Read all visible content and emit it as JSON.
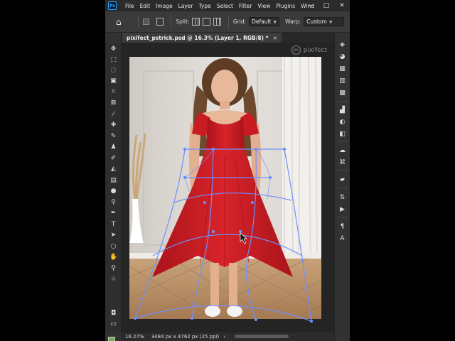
{
  "app": {
    "logo": "Ps",
    "menu": [
      "File",
      "Edit",
      "Image",
      "Layer",
      "Type",
      "Select",
      "Filter",
      "View",
      "Plugins",
      "Wind"
    ],
    "window_controls": {
      "minimize": "—",
      "maximize": "□",
      "close": "✕"
    }
  },
  "options": {
    "split_label": "Split:",
    "grid_label": "Grid:",
    "grid_value": "Default",
    "warp_label": "Warp:",
    "warp_value": "Custom"
  },
  "document": {
    "tab_title": "pixifect_pstrick.psd @ 16.3% (Layer 1, RGB/8) *",
    "close": "×"
  },
  "watermark": {
    "logo": "px",
    "text": "pixifect"
  },
  "status": {
    "zoom": "16.27%",
    "dimensions": "3484 px x 4762 px (25 ppi)",
    "arrow": "›"
  },
  "colors": {
    "foreground": "#6ab04c",
    "background": "#ffffff",
    "warp_mesh": "#6f8fff",
    "dress": "#d01e24"
  },
  "tools": [
    "move-tool",
    "marquee-tool",
    "lasso-tool",
    "object-selection-tool",
    "crop-tool",
    "frame-tool",
    "eyedropper-tool",
    "healing-brush-tool",
    "brush-tool",
    "clone-stamp-tool",
    "history-brush-tool",
    "eraser-tool",
    "gradient-tool",
    "blur-tool",
    "dodge-tool",
    "pen-tool",
    "type-tool",
    "path-selection-tool",
    "ellipse-tool",
    "hand-tool",
    "zoom-tool",
    "edit-toolbar",
    "quick-mask",
    "screen-mode"
  ],
  "panels": [
    "layers-icon",
    "color-icon",
    "swatches-icon",
    "gradients-icon",
    "patterns-icon",
    "histogram-icon",
    "adjustments-icon",
    "navigator-icon",
    "libraries-icon",
    "paths-icon",
    "comments-icon",
    "properties-icon",
    "actions-icon",
    "paragraph-icon",
    "character-icon"
  ]
}
